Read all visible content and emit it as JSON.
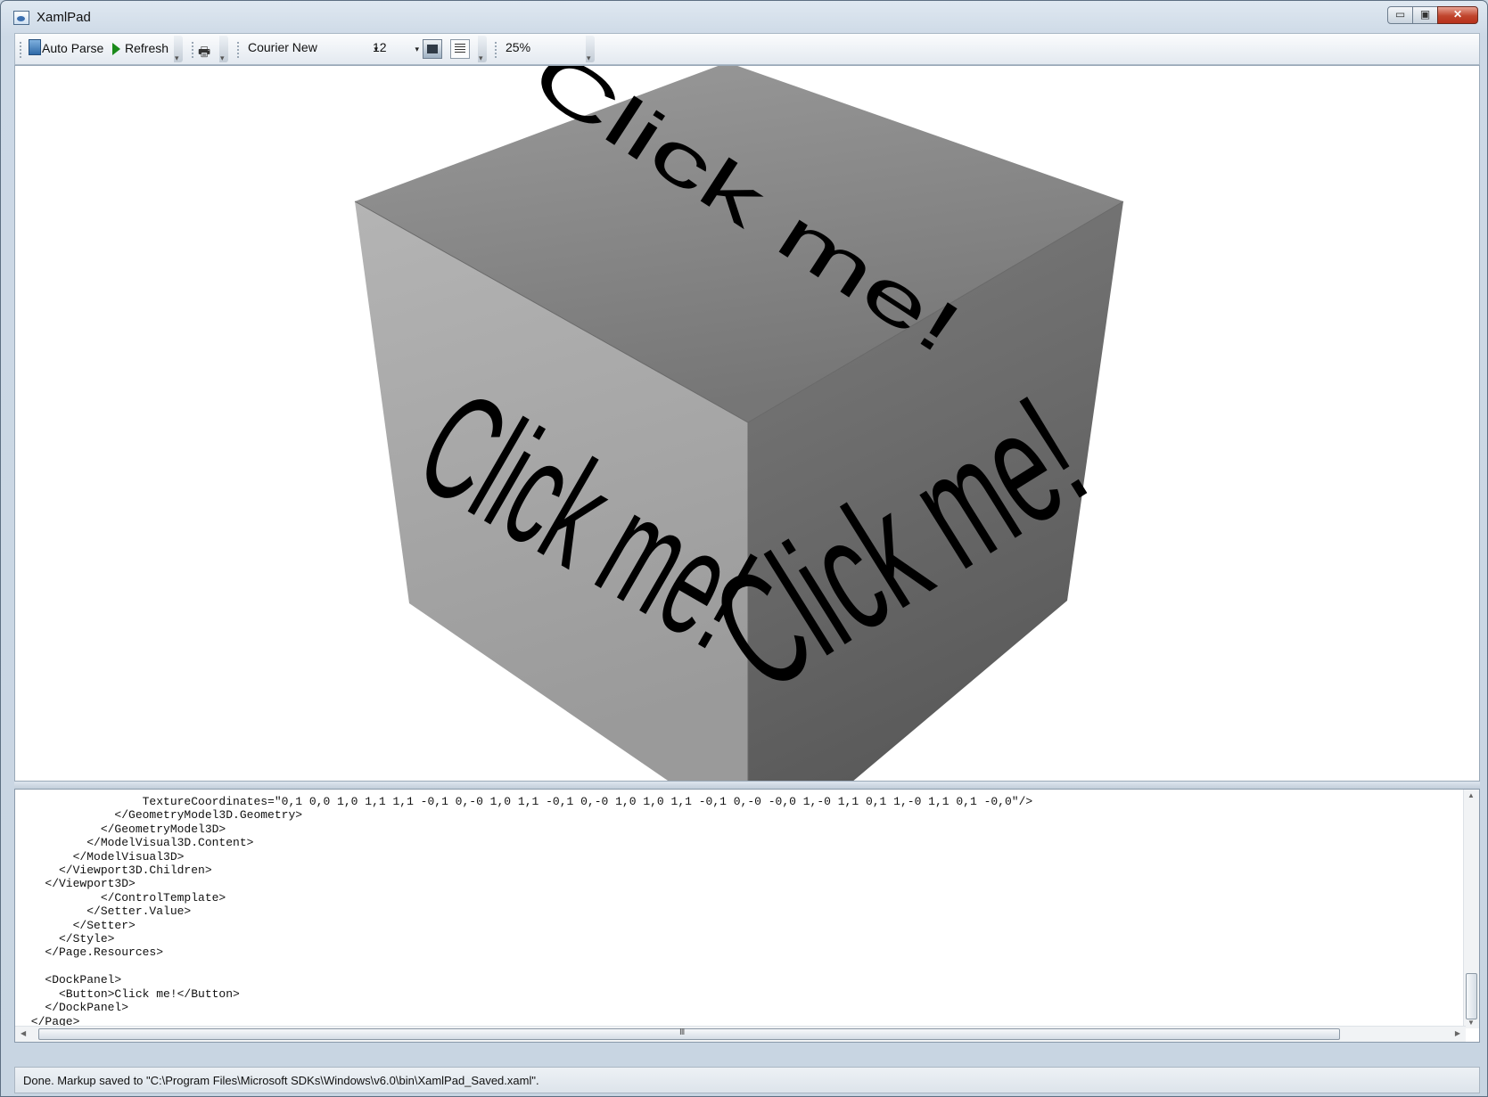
{
  "window": {
    "title": "XamlPad",
    "minimize_glyph": "▭",
    "maximize_glyph": "▣",
    "close_glyph": "✕"
  },
  "toolbar": {
    "auto_parse_label": "Auto Parse",
    "refresh_label": "Refresh",
    "font_family": "Courier New",
    "font_size": "12",
    "zoom": "25%",
    "print_glyph": "🖶",
    "dropdown_glyph": "▾"
  },
  "preview": {
    "cube_top_text": "Click me!",
    "cube_left_text": "Click me!",
    "cube_right_text": "Click me!",
    "colors": {
      "top": "#8a8a8a",
      "left": "#a0a0a0",
      "right": "#6e6e6e",
      "text": "#000000"
    }
  },
  "editor": {
    "lines": [
      "                 TextureCoordinates=\"0,1 0,0 1,0 1,1 1,1 -0,1 0,-0 1,0 1,1 -0,1 0,-0 1,0 1,0 1,1 -0,1 0,-0 -0,0 1,-0 1,1 0,1 1,-0 1,1 0,1 -0,0\"/>",
      "             </GeometryModel3D.Geometry>",
      "           </GeometryModel3D>",
      "         </ModelVisual3D.Content>",
      "       </ModelVisual3D>",
      "     </Viewport3D.Children>",
      "   </Viewport3D>",
      "           </ControlTemplate>",
      "         </Setter.Value>",
      "       </Setter>",
      "     </Style>",
      "   </Page.Resources>",
      "",
      "   <DockPanel>",
      "     <Button>Click me!</Button>",
      "   </DockPanel>",
      " </Page>"
    ],
    "hscroll_grip": "III"
  },
  "status": {
    "text": "Done. Markup saved to \"C:\\Program Files\\Microsoft SDKs\\Windows\\v6.0\\bin\\XamlPad_Saved.xaml\"."
  }
}
